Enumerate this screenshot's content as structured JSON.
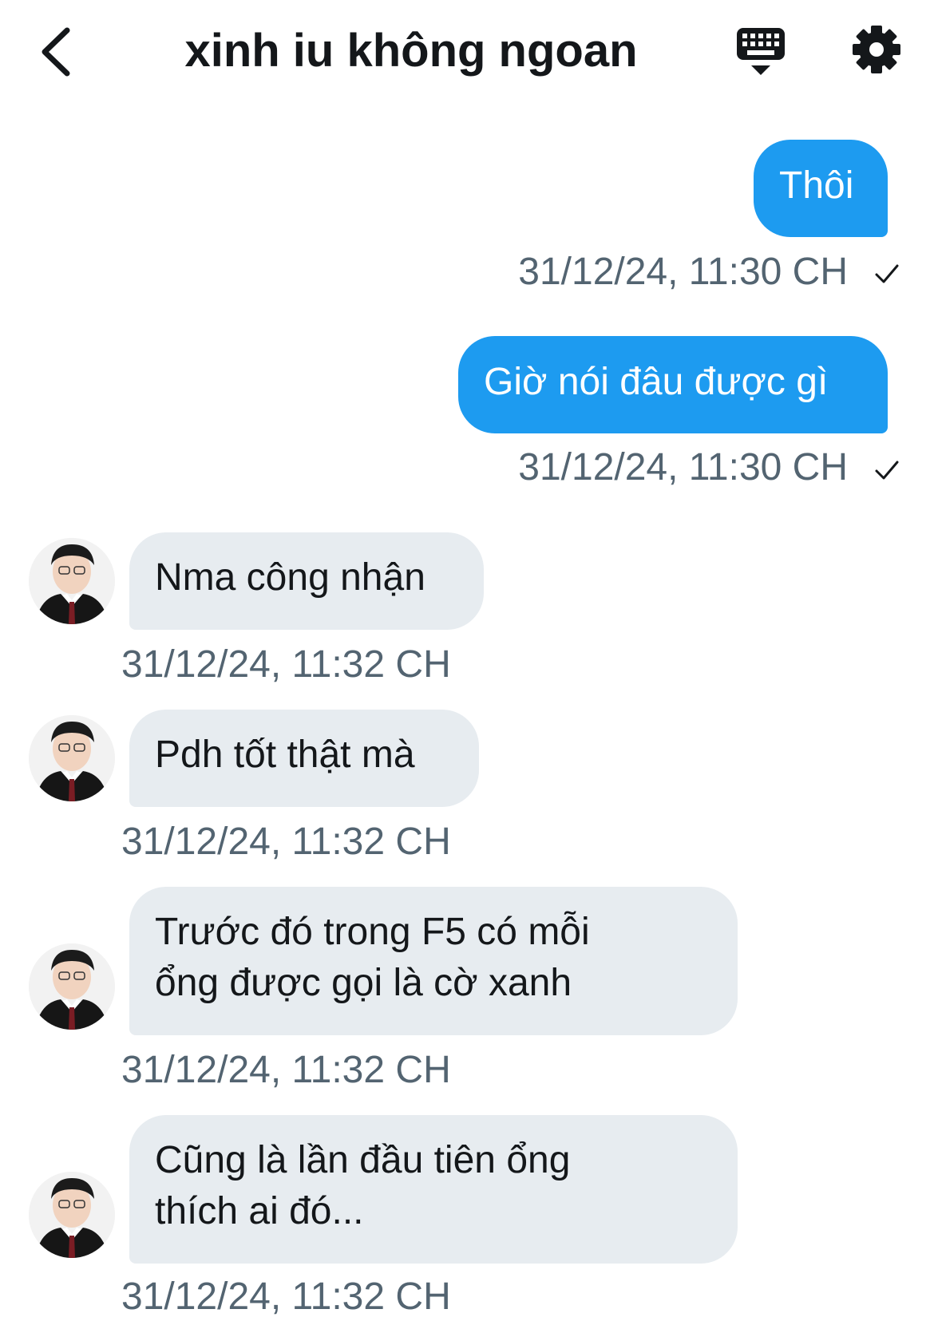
{
  "header": {
    "title": "xinh iu không ngoan",
    "back_icon": "chevron-left-icon",
    "keyboard_icon": "keyboard-icon",
    "settings_icon": "gear-icon"
  },
  "messages": [
    {
      "direction": "out",
      "text": "Thôi",
      "timestamp": "31/12/24, 11:30 CH",
      "status": "sent"
    },
    {
      "direction": "out",
      "text": "Giờ nói đâu được gì",
      "timestamp": "31/12/24, 11:30 CH",
      "status": "sent"
    },
    {
      "direction": "in",
      "text": "Nma công nhận",
      "timestamp": "31/12/24, 11:32 CH"
    },
    {
      "direction": "in",
      "text": "Pdh tốt thật mà",
      "timestamp": "31/12/24, 11:32 CH"
    },
    {
      "direction": "in",
      "lines": [
        "Trước đó trong F5 có mỗi",
        "ổng được gọi là cờ xanh"
      ],
      "timestamp": "31/12/24, 11:32 CH"
    },
    {
      "direction": "in",
      "lines": [
        "Cũng là lần đầu tiên ổng",
        "thích ai đó..."
      ],
      "timestamp": "31/12/24, 11:32 CH"
    }
  ],
  "colors": {
    "outgoing_bubble": "#1d9bf0",
    "incoming_bubble": "#e7ecf0",
    "timestamp": "#536471"
  }
}
